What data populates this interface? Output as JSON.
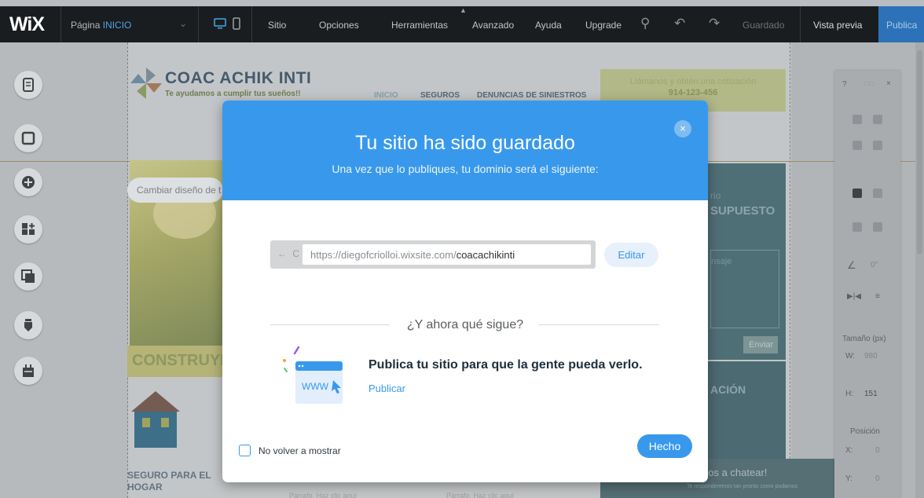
{
  "topbar": {
    "logo": "WiX",
    "page_label": "Página",
    "page_name": "INICIO",
    "menu": [
      "Sitio",
      "Opciones",
      "Herramientas",
      "Avanzado",
      "Ayuda",
      "Upgrade"
    ],
    "saved": "Guardado",
    "preview": "Vista previa",
    "publish": "Publica"
  },
  "site": {
    "title": "COAC ACHIK INTI",
    "tagline": "Te ayudamos a cumplir tus sueños!!",
    "nav": [
      "INICIO",
      "SEGUROS",
      "DENUNCIAS DE SINIESTROS"
    ],
    "call_line1": "Llámanos y obtén una cotización",
    "call_line2": "914-123-456",
    "change_design": "Cambiar diseño de t",
    "construye": "CONSTRUYE",
    "seguro_line1": "SEGURO PARA EL",
    "seguro_line2": "HOGAR",
    "form_label1": "rio",
    "form_label2": "SUPUESTO",
    "form_message": "nsaje",
    "form_send": "Enviar",
    "form2_title": "ACIÓN",
    "chat_title": "nos a chatear!",
    "chat_sub": "Te responderemos tan pronto como podamos",
    "bottom_labels": [
      "Párrafo. Haz clic aquí",
      "Párrafo. Haz clic aquí"
    ]
  },
  "panel": {
    "size_label": "Tamaño (px)",
    "w_label": "W:",
    "w_value": "980",
    "h_label": "H:",
    "h_value": "151",
    "pos_label": "Posición",
    "x_label": "X:",
    "x_value": "0",
    "y_label": "Y:",
    "y_value": "0",
    "angle_value": "0°"
  },
  "modal": {
    "title": "Tu sitio ha sido guardado",
    "subtitle": "Una vez que lo publiques, tu dominio será el siguiente:",
    "url_prefix": "https://diegofcriolloi.wixsite.com/",
    "url_domain": "coacachikinti",
    "edit_label": "Editar",
    "next_heading": "¿Y ahora qué sigue?",
    "publish_title": "Publica tu sitio para que la gente pueda verlo.",
    "publish_link": "Publicar",
    "illustration_text": "WWW",
    "dont_show": "No volver a mostrar",
    "done_label": "Hecho"
  },
  "colors": {
    "accent": "#3899ec",
    "topbar": "#1a1d1f"
  }
}
